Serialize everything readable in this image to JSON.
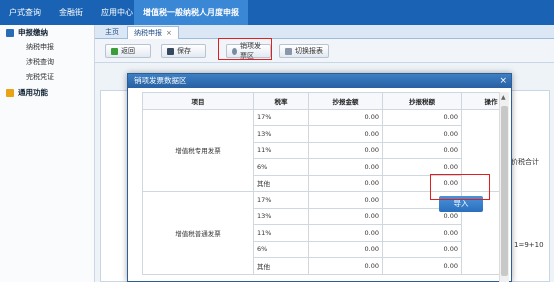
{
  "top_nav": {
    "items": [
      "户式查询",
      "金融街",
      "应用中心"
    ],
    "active": "增值税一般纳税人月度申报"
  },
  "sidebar": {
    "group1": "申报缴纳",
    "items": [
      "纳税申报",
      "涉税查询",
      "完税凭证"
    ],
    "group2": "通用功能"
  },
  "tabs": {
    "home": "主页",
    "active": "纳税申报",
    "close": "×"
  },
  "toolbar": {
    "back": "返回",
    "save": "保存",
    "invoice_area": "销项发票区",
    "switch_report": "切换报表"
  },
  "background": {
    "label_a": "价税合计",
    "label_b": "1=9+10"
  },
  "modal": {
    "title": "销项发票数据区",
    "close": "×",
    "columns": [
      "项目",
      "税率",
      "抄报金额",
      "抄报税额",
      "操作"
    ],
    "groups": [
      {
        "type": "增值税专用发票",
        "rows": [
          {
            "rate": "17%",
            "amount": "0.00",
            "tax": "0.00"
          },
          {
            "rate": "13%",
            "amount": "0.00",
            "tax": "0.00"
          },
          {
            "rate": "11%",
            "amount": "0.00",
            "tax": "0.00"
          },
          {
            "rate": "6%",
            "amount": "0.00",
            "tax": "0.00"
          },
          {
            "rate": "其他",
            "amount": "0.00",
            "tax": "0.00"
          }
        ]
      },
      {
        "type": "增值税普通发票",
        "rows": [
          {
            "rate": "17%",
            "amount": "0.00",
            "tax": "0.00"
          },
          {
            "rate": "13%",
            "amount": "0.00",
            "tax": "0.00"
          },
          {
            "rate": "11%",
            "amount": "0.00",
            "tax": "0.00"
          },
          {
            "rate": "6%",
            "amount": "0.00",
            "tax": "0.00"
          },
          {
            "rate": "其他",
            "amount": "0.00",
            "tax": "0.00"
          }
        ]
      }
    ],
    "import_button": "导入"
  },
  "colors": {
    "topbar": "#1a63b4",
    "highlight": "#e02020",
    "import_button": "#2a6fbe"
  }
}
